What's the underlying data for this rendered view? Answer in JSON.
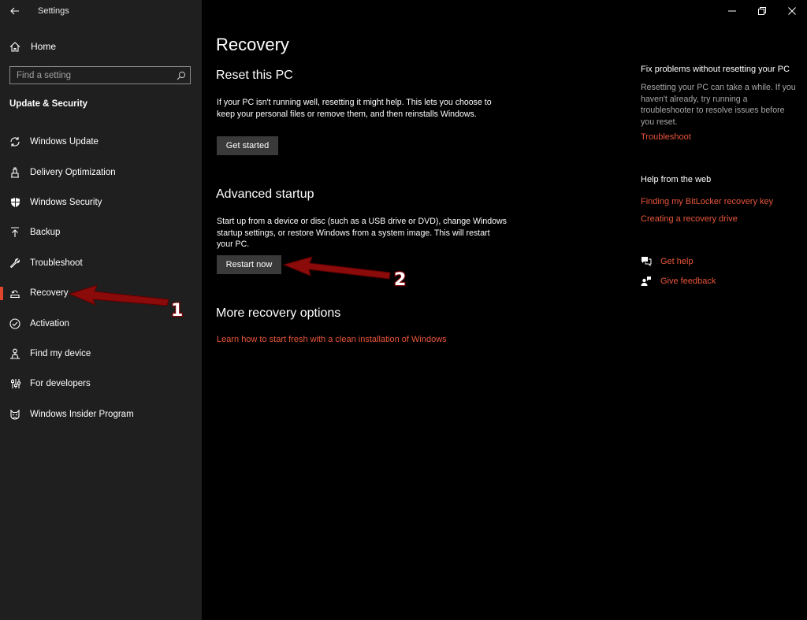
{
  "app": {
    "title": "Settings"
  },
  "sidebar": {
    "home_label": "Home",
    "search_placeholder": "Find a setting",
    "section_title": "Update & Security",
    "items": [
      {
        "label": "Windows Update",
        "icon": "sync-icon"
      },
      {
        "label": "Delivery Optimization",
        "icon": "delivery-optimization-icon"
      },
      {
        "label": "Windows Security",
        "icon": "shield-icon"
      },
      {
        "label": "Backup",
        "icon": "backup-arrow-icon"
      },
      {
        "label": "Troubleshoot",
        "icon": "wrench-icon"
      },
      {
        "label": "Recovery",
        "icon": "recovery-icon",
        "active": true
      },
      {
        "label": "Activation",
        "icon": "check-circle-icon"
      },
      {
        "label": "Find my device",
        "icon": "person-pin-icon"
      },
      {
        "label": "For developers",
        "icon": "developer-sliders-icon"
      },
      {
        "label": "Windows Insider Program",
        "icon": "insider-cat-icon"
      }
    ]
  },
  "main": {
    "title": "Recovery",
    "reset": {
      "heading": "Reset this PC",
      "description": "If your PC isn't running well, resetting it might help. This lets you choose to keep your personal files or remove them, and then reinstalls Windows.",
      "button": "Get started"
    },
    "advanced": {
      "heading": "Advanced startup",
      "description": "Start up from a device or disc (such as a USB drive or DVD), change Windows startup settings, or restore Windows from a system image. This will restart your PC.",
      "button": "Restart now"
    },
    "more": {
      "heading": "More recovery options",
      "link": "Learn how to start fresh with a clean installation of Windows"
    }
  },
  "right_pane": {
    "fix_heading": "Fix problems without resetting your PC",
    "fix_text": "Resetting your PC can take a while. If you haven't already, try running a troubleshooter to resolve issues before you reset.",
    "fix_link": "Troubleshoot",
    "web_heading": "Help from the web",
    "web_links": [
      "Finding my BitLocker recovery key",
      "Creating a recovery drive"
    ],
    "get_help": "Get help",
    "give_feedback": "Give feedback"
  },
  "annotations": {
    "marker1": "1",
    "marker2": "2"
  },
  "colors": {
    "accent": "#e8553a",
    "sidebar_bg": "#1f1f1f",
    "main_bg": "#000000",
    "arrow": "#8b0a0a"
  }
}
